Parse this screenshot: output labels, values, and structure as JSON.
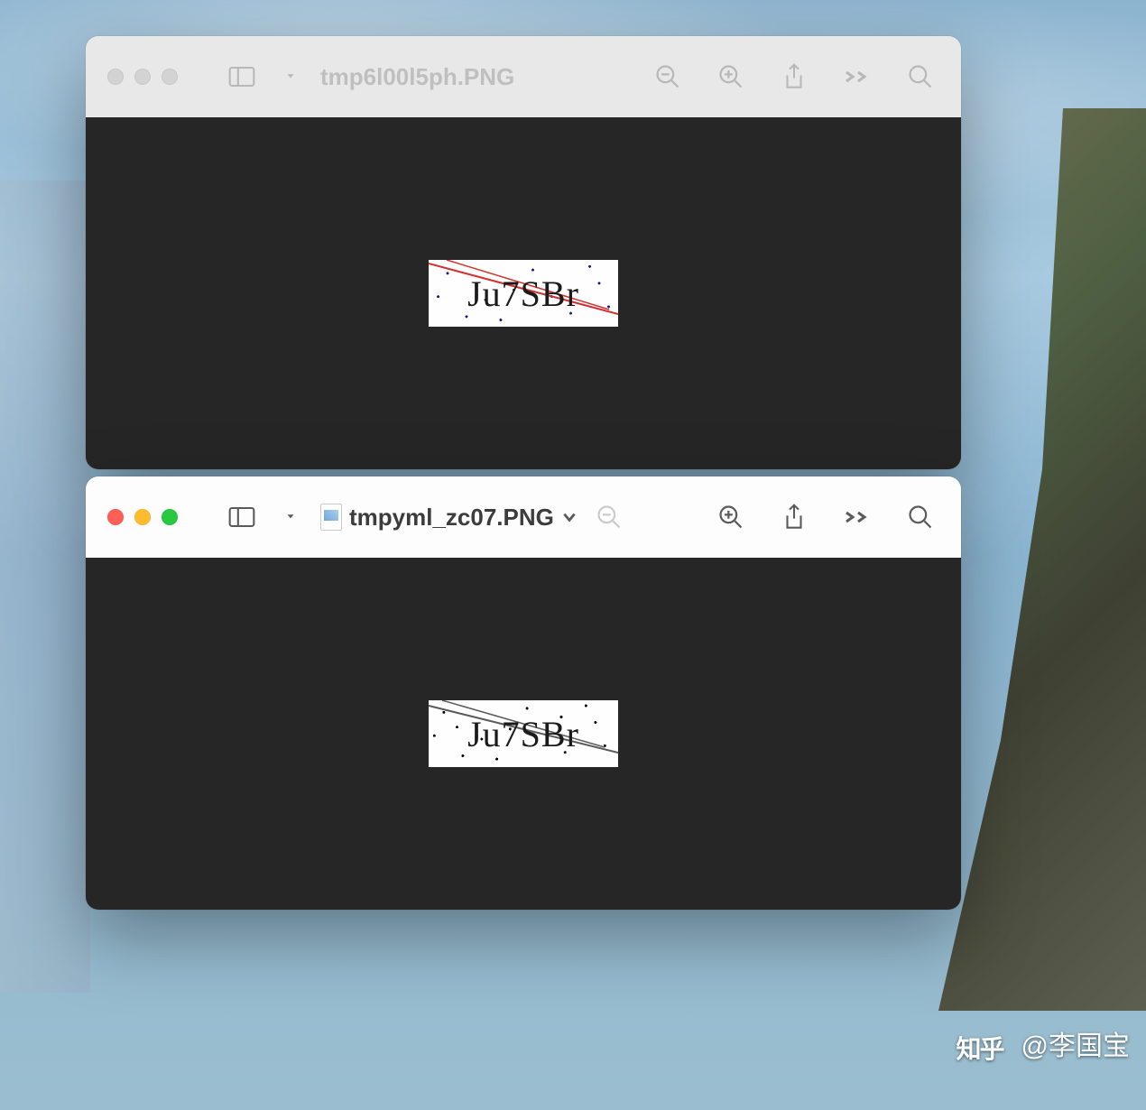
{
  "window1": {
    "title": "tmp6l00l5ph.PNG",
    "active": false,
    "captcha_text": "Ju7SBr",
    "captcha_line_color": "#d43030"
  },
  "window2": {
    "title": "tmpyml_zc07.PNG",
    "active": true,
    "captcha_text": "Ju7SBr",
    "captcha_line_color": "#5a5a5a"
  },
  "watermark": {
    "platform": "知乎",
    "author": "@李国宝"
  }
}
